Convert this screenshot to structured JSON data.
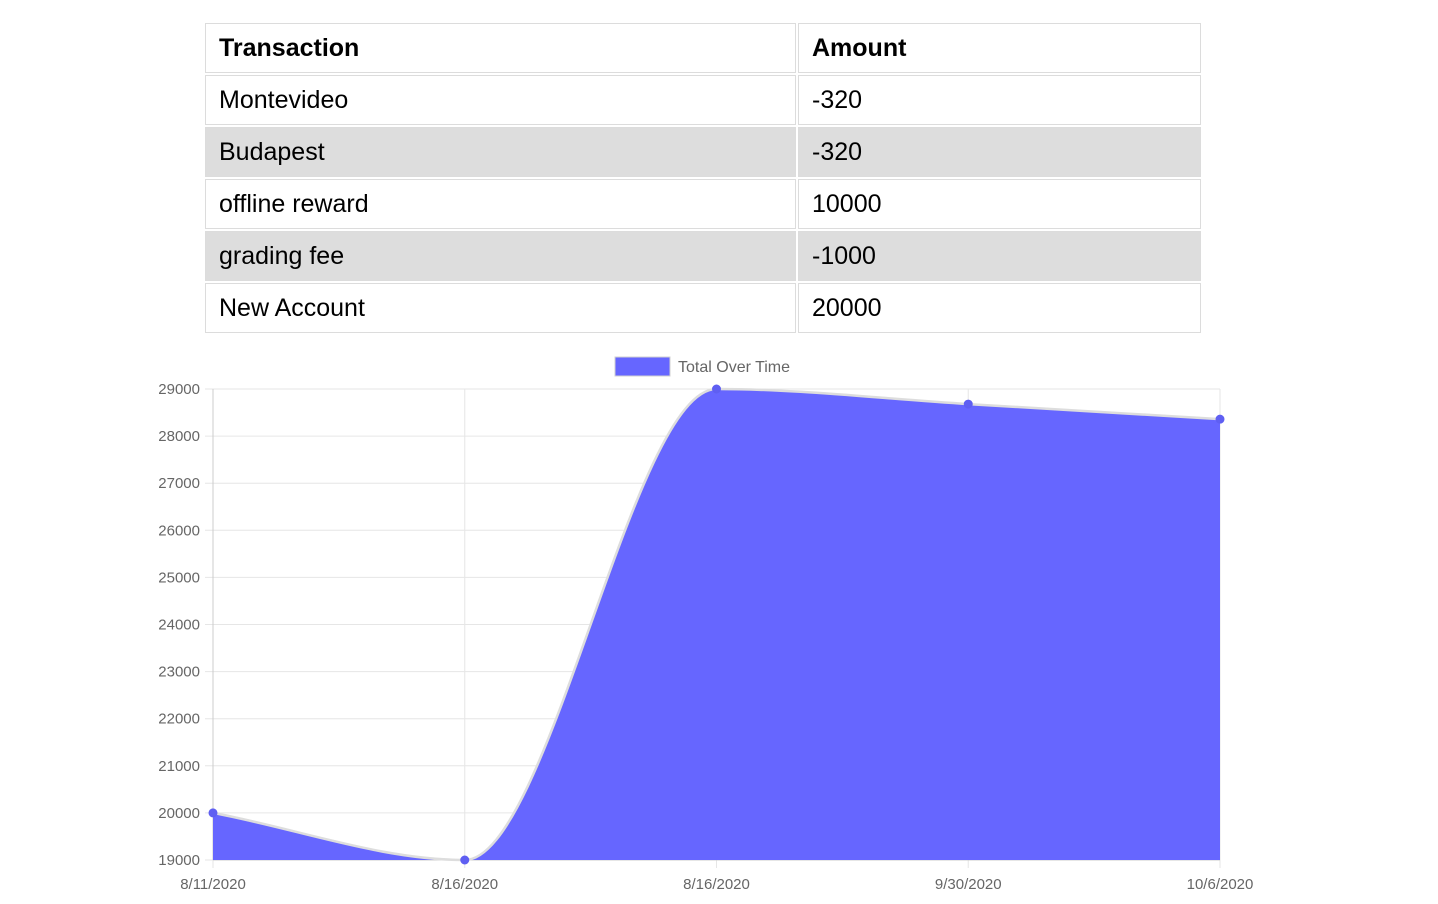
{
  "table": {
    "headers": [
      "Transaction",
      "Amount"
    ],
    "rows": [
      {
        "name": "Montevideo",
        "amount": "-320"
      },
      {
        "name": "Budapest",
        "amount": "-320"
      },
      {
        "name": "offline reward",
        "amount": "10000"
      },
      {
        "name": "grading fee",
        "amount": "-1000"
      },
      {
        "name": "New Account",
        "amount": "20000"
      }
    ]
  },
  "chart_data": {
    "type": "area",
    "categories": [
      "8/11/2020",
      "8/16/2020",
      "8/16/2020",
      "9/30/2020",
      "10/6/2020"
    ],
    "series": [
      {
        "name": "Total Over Time",
        "values": [
          20000,
          19000,
          29000,
          28680,
          28360
        ],
        "color": "#6666ff"
      }
    ],
    "ylim": [
      19000,
      29000
    ],
    "yticks": [
      19000,
      20000,
      21000,
      22000,
      23000,
      24000,
      25000,
      26000,
      27000,
      28000,
      29000
    ],
    "grid": true,
    "legend": "top-center"
  },
  "colors": {
    "fill": "#6666ff",
    "line": "#dddddd",
    "point": "#5f5ff2",
    "grid": "#e6e6e6",
    "row_shade": "#dddddd"
  }
}
